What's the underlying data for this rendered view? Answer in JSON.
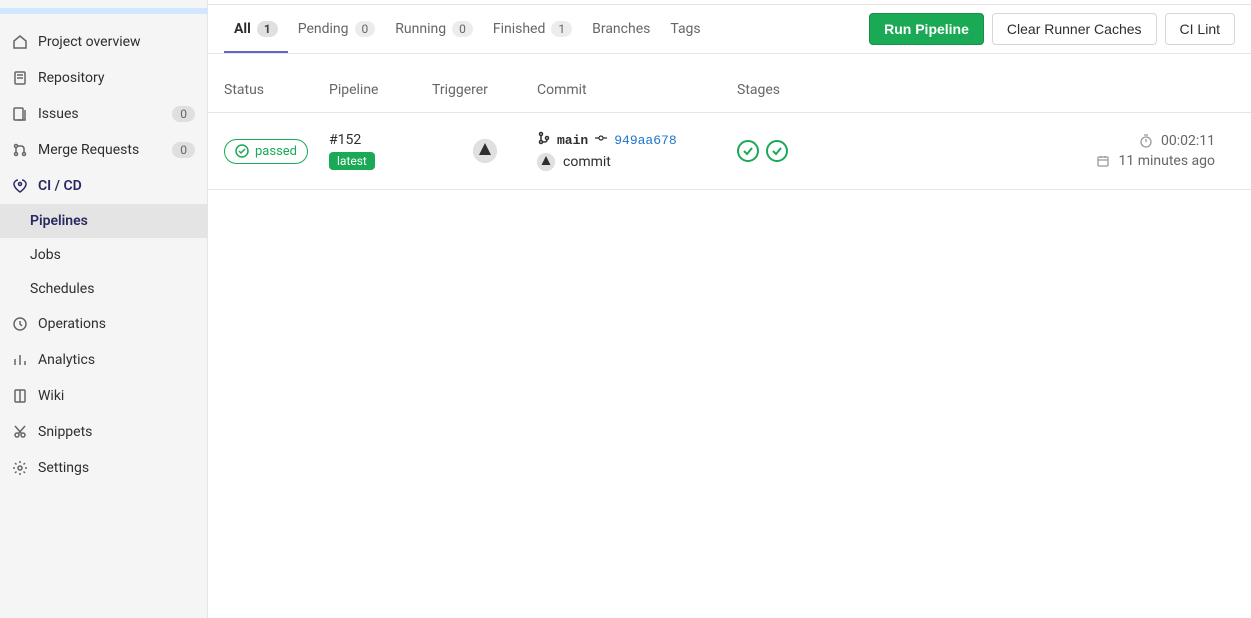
{
  "sidebar": {
    "items": [
      {
        "label": "Project overview",
        "icon": "home-icon"
      },
      {
        "label": "Repository",
        "icon": "file-icon"
      },
      {
        "label": "Issues",
        "icon": "issues-icon",
        "count": "0"
      },
      {
        "label": "Merge Requests",
        "icon": "merge-icon",
        "count": "0"
      },
      {
        "label": "CI / CD",
        "icon": "rocket-icon",
        "active": true
      },
      {
        "label": "Operations",
        "icon": "operations-icon"
      },
      {
        "label": "Analytics",
        "icon": "chart-icon"
      },
      {
        "label": "Wiki",
        "icon": "book-icon"
      },
      {
        "label": "Snippets",
        "icon": "scissors-icon"
      },
      {
        "label": "Settings",
        "icon": "gear-icon"
      }
    ],
    "sub": [
      {
        "label": "Pipelines",
        "active": true
      },
      {
        "label": "Jobs"
      },
      {
        "label": "Schedules"
      }
    ]
  },
  "tabs": [
    {
      "label": "All",
      "count": "1",
      "active": true
    },
    {
      "label": "Pending",
      "count": "0"
    },
    {
      "label": "Running",
      "count": "0"
    },
    {
      "label": "Finished",
      "count": "1"
    },
    {
      "label": "Branches"
    },
    {
      "label": "Tags"
    }
  ],
  "actions": {
    "run": "Run Pipeline",
    "clear": "Clear Runner Caches",
    "lint": "CI Lint"
  },
  "columns": {
    "status": "Status",
    "pipeline": "Pipeline",
    "triggerer": "Triggerer",
    "commit": "Commit",
    "stages": "Stages"
  },
  "row": {
    "status": "passed",
    "pipeline_id": "#152",
    "pipeline_tag": "latest",
    "branch": "main",
    "sha": "949aa678",
    "commit_msg": "commit",
    "duration": "00:02:11",
    "finished": "11 minutes ago"
  }
}
